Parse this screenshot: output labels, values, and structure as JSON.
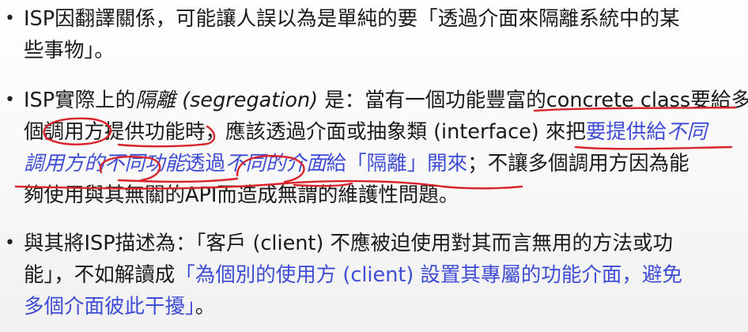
{
  "slide": {
    "bullets": [
      {
        "lines": [
          [
            {
              "t": "ISP因翻譯關係，可能讓人誤以為是單純的要「透過介面來隔離系統中的某",
              "c": ""
            }
          ],
          [
            {
              "t": "些事物」。",
              "c": ""
            }
          ]
        ]
      },
      {
        "lines": [
          [
            {
              "t": "ISP實際上的",
              "c": ""
            },
            {
              "t": "隔離 (segregation)",
              "c": "it"
            },
            {
              "t": " 是：當有一個功能豐富的concrete class要給多",
              "c": ""
            }
          ],
          [
            {
              "t": "個調用方提供功能時，應該透過介面或抽象類 (interface) 來把",
              "c": ""
            },
            {
              "t": "要提供給",
              "c": "blue"
            },
            {
              "t": "不同",
              "c": "blue it"
            }
          ],
          [
            {
              "t": "調用方的",
              "c": "blue it"
            },
            {
              "t": "不同功能",
              "c": "blue it"
            },
            {
              "t": "透過",
              "c": "blue"
            },
            {
              "t": "不同的介面",
              "c": "blue it"
            },
            {
              "t": "給「隔離」開來",
              "c": "blue"
            },
            {
              "t": "；不讓多個調用方因為能",
              "c": ""
            }
          ],
          [
            {
              "t": "夠使用與其無關的API而造成無謂的維護性問題。",
              "c": ""
            }
          ]
        ]
      },
      {
        "lines": [
          [
            {
              "t": "與其將ISP描述為：「客戶 (client) 不應被迫使用對其而言無用的方法或功",
              "c": ""
            }
          ],
          [
            {
              "t": "能」，不如解讀成",
              "c": ""
            },
            {
              "t": "「為個別的使用方 (client) 設置其專屬的功能介面，避免",
              "c": "blue"
            }
          ],
          [
            {
              "t": "多個介面彼此干擾」",
              "c": "blue"
            },
            {
              "t": "。",
              "c": ""
            }
          ]
        ]
      }
    ],
    "colors": {
      "text": "#1a1a1a",
      "accent_blue": "#3f4dd6",
      "annotation_red": "#d8242a"
    }
  }
}
